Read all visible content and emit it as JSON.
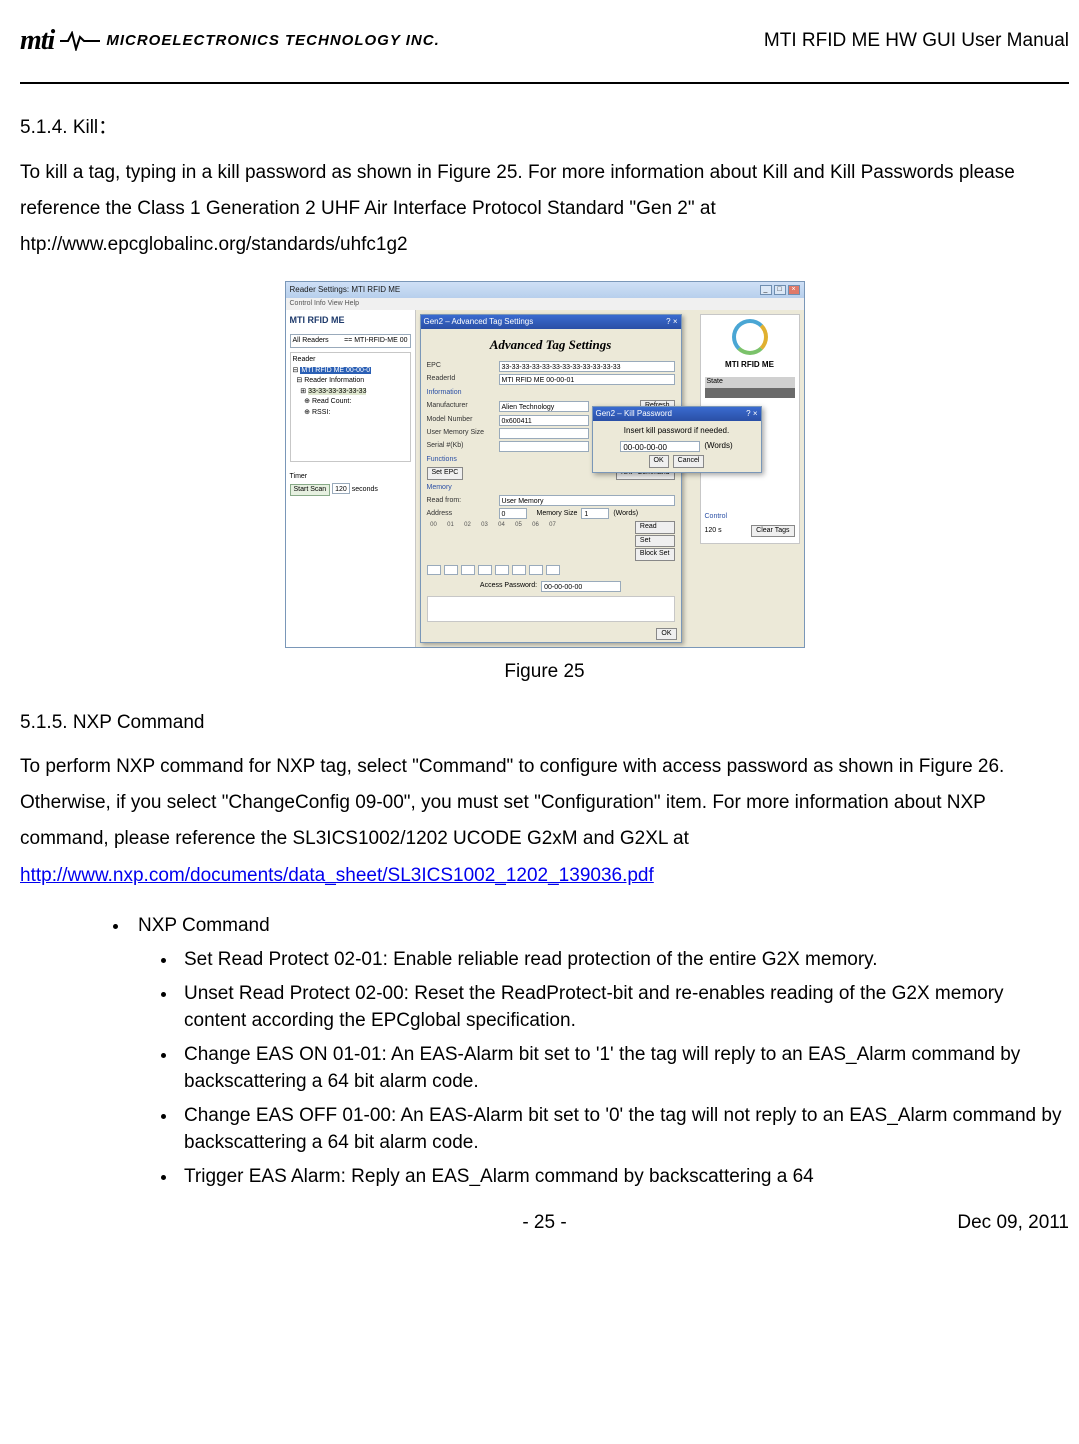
{
  "header": {
    "logo_mark": "mti",
    "logo_text": "MICROELECTRONICS TECHNOLOGY INC.",
    "title": "MTI RFID ME HW GUI User Manual"
  },
  "section_514": {
    "heading": "5.1.4. Kill：",
    "body": "To kill a tag, typing in a kill password as shown in Figure 25. For more information about Kill and Kill Passwords please reference the Class 1 Generation 2 UHF Air Interface Protocol Standard \"Gen 2\" at htp://www.epcglobalinc.org/standards/uhfc1g2"
  },
  "figure25": {
    "caption": "Figure 25",
    "main_window_title": "Reader Settings: MTI RFID ME",
    "menubar": "Control  Info  View  Help",
    "brand": "MTI RFID ME",
    "combo_label": "All Readers",
    "combo_value": "== MTI-RFID-ME 00",
    "tree_group": "Reader",
    "tree_item_hl": "MTI RFID ME 00-00-0",
    "tree_sub1_label": "Reader Information",
    "tree_sub2_label": "33-33-33-33-33-33",
    "tree_sub3_label": "Read Count:",
    "tree_sub4_label": "RSSI:",
    "timer_label_1": "Timer",
    "timer_btn": "Start Scan",
    "timer_value": "120",
    "timer_unit": "seconds",
    "dialog_title": "Gen2 – Advanced Tag Settings",
    "dialog_heading": "Advanced Tag Settings",
    "epc_label": "EPC",
    "epc_value": "33-33-33-33-33-33-33-33-33-33-33-33",
    "readerid_label": "ReaderId",
    "readerid_value": "MTI RFID ME 00-00-01",
    "info_group": "Information",
    "manufacturer_label": "Manufacturer",
    "manufacturer_value": "Alien Technology",
    "model_label": "Model Number",
    "model_value": "0x600411",
    "usermem_label": "User Memory Size",
    "usermem_value": "",
    "serial_label": "Serial #(Kb)",
    "serial_value": "",
    "refresh_btn": "Refresh",
    "functions_group": "Functions",
    "setepc_btn": "Set EPC",
    "nxpcmd_btn": "NXP Command",
    "memory_group": "Memory",
    "readfrom_label": "Read from:",
    "readfrom_value": "User Memory",
    "address_label": "Address",
    "address_value": "0",
    "memsize_label": "Memory Size",
    "memsize_value": "1",
    "memsize_unit": "(Words)",
    "bytes": [
      "00",
      "01",
      "02",
      "03",
      "04",
      "05",
      "06",
      "07"
    ],
    "read_btn": "Read",
    "set_btn": "Set",
    "blockset_btn": "Block Set",
    "accesspw_label": "Access Password:",
    "accesspw_value": "00-00-00-00",
    "ok_btn": "OK",
    "kill_title": "Gen2 – Kill Password",
    "kill_msg": "Insert kill password if needed.",
    "kill_value": "00-00-00-00",
    "kill_unit": "(Words)",
    "kill_ok": "OK",
    "kill_cancel": "Cancel",
    "right_brand": "MTI RFID ME",
    "state_head": "State",
    "control_head": "Control",
    "control_value": "120 s",
    "cleartags_btn": "Clear Tags"
  },
  "section_515": {
    "heading": "5.1.5. NXP Command",
    "body": "To perform NXP command for NXP tag, select \"Command\" to configure with access password as shown in Figure 26. Otherwise, if you select \"ChangeConfig 09-00\", you must set \"Configuration\" item. For more information about NXP command, please reference the SL3ICS1002/1202 UCODE G2xM and G2XL at",
    "link_text": "http://www.nxp.com/documents/data_sheet/SL3ICS1002_1202_139036.pdf",
    "l1_item": "NXP Command",
    "l2": [
      "Set Read Protect 02-01: Enable reliable read protection of the entire G2X memory.",
      "Unset Read Protect 02-00: Reset the ReadProtect-bit and re-enables reading of the G2X memory content according the EPCglobal specification.",
      "Change EAS ON 01-01: An EAS-Alarm bit set to '1' the tag will reply to an EAS_Alarm command by backscattering a 64 bit alarm code.",
      "Change EAS OFF 01-00: An EAS-Alarm bit set to '0' the tag will not reply to an EAS_Alarm command by backscattering a 64 bit alarm code.",
      "Trigger EAS Alarm: Reply an EAS_Alarm command by backscattering a 64"
    ]
  },
  "footer": {
    "page": "- 25 -",
    "date": "Dec 09, 2011"
  }
}
